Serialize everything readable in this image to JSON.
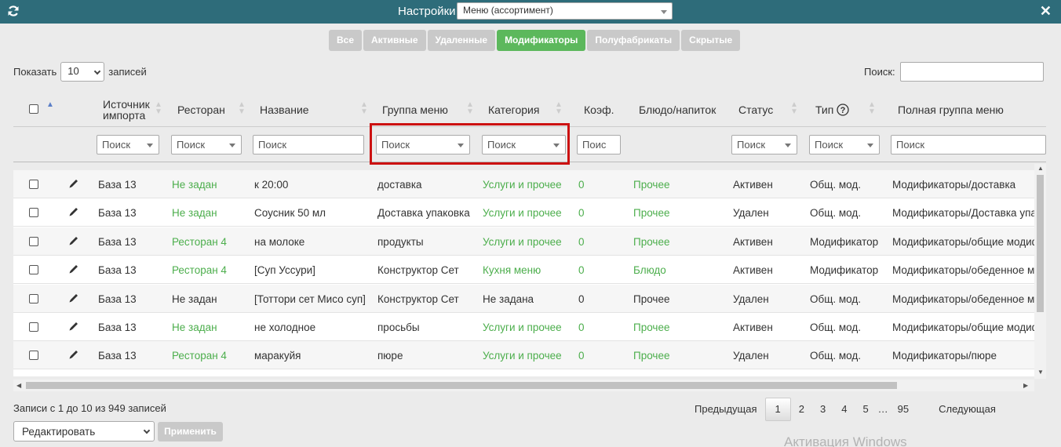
{
  "header": {
    "title": "Настройки",
    "menu_select": "Меню (ассортимент)"
  },
  "tabs": [
    {
      "label": "Все",
      "active": false
    },
    {
      "label": "Активные",
      "active": false
    },
    {
      "label": "Удаленные",
      "active": false
    },
    {
      "label": "Модификаторы",
      "active": true
    },
    {
      "label": "Полуфабрикаты",
      "active": false
    },
    {
      "label": "Скрытые",
      "active": false
    }
  ],
  "length": {
    "prefix": "Показать",
    "value": "10",
    "suffix": "записей"
  },
  "search": {
    "label": "Поиск:"
  },
  "columns": {
    "source": "Источник импорта",
    "restaurant": "Ресторан",
    "name": "Название",
    "menu_group": "Группа меню",
    "category": "Категория",
    "coef": "Коэф.",
    "dish": "Блюдо/напиток",
    "status": "Статус",
    "type": "Тип",
    "full_group": "Полная группа меню"
  },
  "filter_placeholder": "Поиск",
  "filter_coef_placeholder": "Поис",
  "rows": [
    {
      "source": "База 13",
      "restaurant": "Не задан",
      "rest_green": true,
      "name": "к 20:00",
      "group": "доставка",
      "category": "Услуги и прочее",
      "cat_green": true,
      "coef": "0",
      "dish": "Прочее",
      "dish_green": true,
      "status": "Активен",
      "type": "Общ. мод.",
      "full": "Модификаторы/доставка"
    },
    {
      "source": "База 13",
      "restaurant": "Не задан",
      "rest_green": true,
      "name": "Соусник 50 мл",
      "group": "Доставка упаковка",
      "category": "Услуги и прочее",
      "cat_green": true,
      "coef": "0",
      "dish": "Прочее",
      "dish_green": true,
      "status": "Удален",
      "type": "Общ. мод.",
      "full": "Модификаторы/Доставка упаковка"
    },
    {
      "source": "База 13",
      "restaurant": "Ресторан 4",
      "rest_green": true,
      "name": "на молоке",
      "group": "продукты",
      "category": "Услуги и прочее",
      "cat_green": true,
      "coef": "0",
      "dish": "Прочее",
      "dish_green": true,
      "status": "Активен",
      "type": "Модификатор",
      "full": "Модификаторы/общие модификаторы"
    },
    {
      "source": "База 13",
      "restaurant": "Ресторан 4",
      "rest_green": true,
      "name": "[Суп Уссури]",
      "group": "Конструктор Сет",
      "category": "Кухня меню",
      "cat_green": true,
      "coef": "0",
      "dish": "Блюдо",
      "dish_green": true,
      "status": "Активен",
      "type": "Модификатор",
      "full": "Модификаторы/обеденное меню"
    },
    {
      "source": "База 13",
      "restaurant": "Не задан",
      "rest_green": false,
      "name": "[Тоттори сет Мисо суп]",
      "group": "Конструктор Сет",
      "category": "Не задана",
      "cat_green": false,
      "coef": "0",
      "dish": "Прочее",
      "dish_green": false,
      "status": "Удален",
      "type": "Общ. мод.",
      "full": "Модификаторы/обеденное меню"
    },
    {
      "source": "База 13",
      "restaurant": "Не задан",
      "rest_green": true,
      "name": "не холодное",
      "group": "просьбы",
      "category": "Услуги и прочее",
      "cat_green": true,
      "coef": "0",
      "dish": "Прочее",
      "dish_green": true,
      "status": "Активен",
      "type": "Общ. мод.",
      "full": "Модификаторы/общие модификаторы"
    },
    {
      "source": "База 13",
      "restaurant": "Ресторан 4",
      "rest_green": true,
      "name": "маракуйя",
      "group": "пюре",
      "category": "Услуги и прочее",
      "cat_green": true,
      "coef": "0",
      "dish": "Прочее",
      "dish_green": true,
      "status": "Удален",
      "type": "Общ. мод.",
      "full": "Модификаторы/пюре"
    }
  ],
  "footer": {
    "info": "Записи с 1 до 10 из 949 записей",
    "prev": "Предыдущая",
    "pages": [
      "1",
      "2",
      "3",
      "4",
      "5",
      "…",
      "95"
    ],
    "next": "Следующая",
    "bulk_action": "Редактировать",
    "apply": "Применить"
  },
  "watermark": "Активация Windows",
  "colors": {
    "header_bg": "#2e6c7a",
    "active_tab": "#5cb85c",
    "link_green": "#4cae4c",
    "highlight": "#cc1111"
  }
}
